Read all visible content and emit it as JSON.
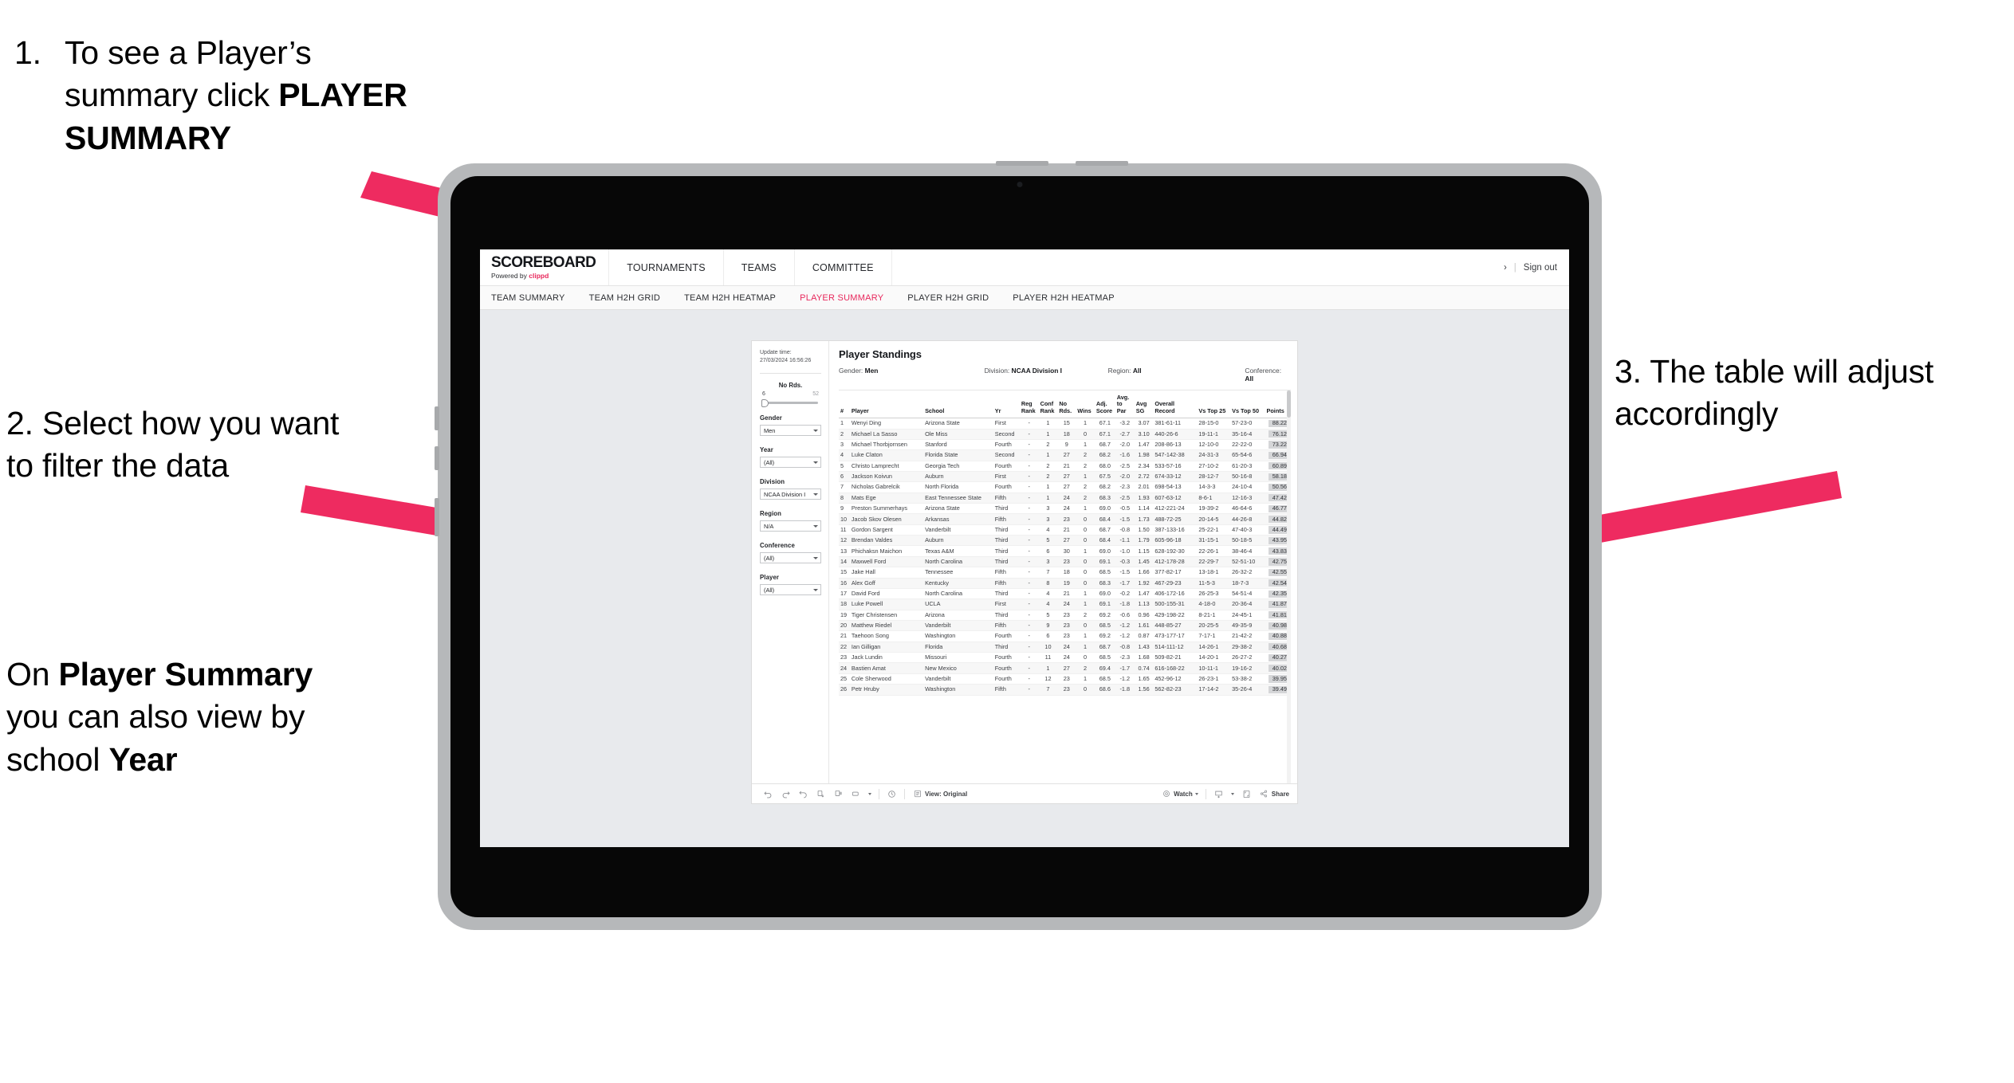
{
  "annotations": {
    "step1": {
      "number": "1.",
      "line1": "To see a Player’s",
      "line2_pre": "summary click ",
      "line2_bold": "PLAYER",
      "line3_bold": "SUMMARY"
    },
    "step2": {
      "text": "2. Select how you want to filter the data"
    },
    "step2b": {
      "pre": "On ",
      "bold1": "Player Summary",
      "mid": " you can also view by school ",
      "bold2": "Year"
    },
    "step3": {
      "text": "3. The table will adjust accordingly"
    }
  },
  "app": {
    "brand": {
      "name": "SCOREBOARD",
      "powered_by": "Powered by ",
      "vendor": "clippd"
    },
    "topnav": [
      "TOURNAMENTS",
      "TEAMS",
      "COMMITTEE"
    ],
    "top_right": {
      "chevron": "›",
      "divider": "|",
      "sign_out": "Sign out"
    },
    "subnav": [
      {
        "label": "TEAM SUMMARY",
        "active": false
      },
      {
        "label": "TEAM H2H GRID",
        "active": false
      },
      {
        "label": "TEAM H2H HEATMAP",
        "active": false
      },
      {
        "label": "PLAYER SUMMARY",
        "active": true
      },
      {
        "label": "PLAYER H2H GRID",
        "active": false
      },
      {
        "label": "PLAYER H2H HEATMAP",
        "active": false
      }
    ],
    "accent_color": "#e8285c"
  },
  "filters": {
    "update_time_label": "Update time:",
    "update_time_value": "27/03/2024 16:56:26",
    "slider": {
      "title": "No Rds.",
      "min": "6",
      "max": "52"
    },
    "groups": [
      {
        "title": "Gender",
        "value": "Men"
      },
      {
        "title": "Year",
        "value": "(All)"
      },
      {
        "title": "Division",
        "value": "NCAA Division I"
      },
      {
        "title": "Region",
        "value": "N/A"
      },
      {
        "title": "Conference",
        "value": "(All)"
      },
      {
        "title": "Player",
        "value": "(All)"
      }
    ]
  },
  "viz": {
    "title": "Player Standings",
    "active_filters": [
      {
        "label": "Gender: ",
        "value": "Men"
      },
      {
        "label": "Division: ",
        "value": "NCAA Division I"
      },
      {
        "label": "Region: ",
        "value": "All"
      },
      {
        "label": "Conference: ",
        "value": "All"
      }
    ],
    "columns": [
      "#",
      "Player",
      "School",
      "Yr",
      "Reg\nRank",
      "Conf\nRank",
      "No\nRds.",
      "Wins",
      "Adj.\nScore",
      "Avg.\nto Par",
      "Avg\nSG",
      "Overall\nRecord",
      "Vs Top 25",
      "Vs Top 50",
      "Points"
    ],
    "rows": [
      [
        "1",
        "Wenyi Ding",
        "Arizona State",
        "First",
        "-",
        "1",
        "15",
        "1",
        "67.1",
        "-3.2",
        "3.07",
        "381-61-11",
        "28-15-0",
        "57-23-0",
        "88.22"
      ],
      [
        "2",
        "Michael La Sasso",
        "Ole Miss",
        "Second",
        "-",
        "1",
        "18",
        "0",
        "67.1",
        "-2.7",
        "3.10",
        "440-26-6",
        "19-11-1",
        "35-16-4",
        "76.12"
      ],
      [
        "3",
        "Michael Thorbjornsen",
        "Stanford",
        "Fourth",
        "-",
        "2",
        "9",
        "1",
        "68.7",
        "-2.0",
        "1.47",
        "208-86-13",
        "12-10-0",
        "22-22-0",
        "73.22"
      ],
      [
        "4",
        "Luke Claton",
        "Florida State",
        "Second",
        "-",
        "1",
        "27",
        "2",
        "68.2",
        "-1.6",
        "1.98",
        "547-142-38",
        "24-31-3",
        "65-54-6",
        "66.94"
      ],
      [
        "5",
        "Christo Lamprecht",
        "Georgia Tech",
        "Fourth",
        "-",
        "2",
        "21",
        "2",
        "68.0",
        "-2.5",
        "2.34",
        "533-57-16",
        "27-10-2",
        "61-20-3",
        "60.89"
      ],
      [
        "6",
        "Jackson Koivun",
        "Auburn",
        "First",
        "-",
        "2",
        "27",
        "1",
        "67.5",
        "-2.0",
        "2.72",
        "674-33-12",
        "28-12-7",
        "50-16-8",
        "58.18"
      ],
      [
        "7",
        "Nicholas Gabrelcik",
        "North Florida",
        "Fourth",
        "-",
        "1",
        "27",
        "2",
        "68.2",
        "-2.3",
        "2.01",
        "698-54-13",
        "14-3-3",
        "24-10-4",
        "50.56"
      ],
      [
        "8",
        "Mats Ege",
        "East Tennessee State",
        "Fifth",
        "-",
        "1",
        "24",
        "2",
        "68.3",
        "-2.5",
        "1.93",
        "607-63-12",
        "8-6-1",
        "12-16-3",
        "47.42"
      ],
      [
        "9",
        "Preston Summerhays",
        "Arizona State",
        "Third",
        "-",
        "3",
        "24",
        "1",
        "69.0",
        "-0.5",
        "1.14",
        "412-221-24",
        "19-39-2",
        "46-64-6",
        "46.77"
      ],
      [
        "10",
        "Jacob Skov Olesen",
        "Arkansas",
        "Fifth",
        "-",
        "3",
        "23",
        "0",
        "68.4",
        "-1.5",
        "1.73",
        "488-72-25",
        "20-14-5",
        "44-26-8",
        "44.82"
      ],
      [
        "11",
        "Gordon Sargent",
        "Vanderbilt",
        "Third",
        "-",
        "4",
        "21",
        "0",
        "68.7",
        "-0.8",
        "1.50",
        "387-133-16",
        "25-22-1",
        "47-40-3",
        "44.49"
      ],
      [
        "12",
        "Brendan Valdes",
        "Auburn",
        "Third",
        "-",
        "5",
        "27",
        "0",
        "68.4",
        "-1.1",
        "1.79",
        "605-96-18",
        "31-15-1",
        "50-18-5",
        "43.95"
      ],
      [
        "13",
        "Phichaksn Maichon",
        "Texas A&M",
        "Third",
        "-",
        "6",
        "30",
        "1",
        "69.0",
        "-1.0",
        "1.15",
        "628-192-30",
        "22-26-1",
        "38-46-4",
        "43.83"
      ],
      [
        "14",
        "Maxwell Ford",
        "North Carolina",
        "Third",
        "-",
        "3",
        "23",
        "0",
        "69.1",
        "-0.3",
        "1.45",
        "412-178-28",
        "22-29-7",
        "52-51-10",
        "42.75"
      ],
      [
        "15",
        "Jake Hall",
        "Tennessee",
        "Fifth",
        "-",
        "7",
        "18",
        "0",
        "68.5",
        "-1.5",
        "1.66",
        "377-82-17",
        "13-18-1",
        "26-32-2",
        "42.55"
      ],
      [
        "16",
        "Alex Goff",
        "Kentucky",
        "Fifth",
        "-",
        "8",
        "19",
        "0",
        "68.3",
        "-1.7",
        "1.92",
        "467-29-23",
        "11-5-3",
        "18-7-3",
        "42.54"
      ],
      [
        "17",
        "David Ford",
        "North Carolina",
        "Third",
        "-",
        "4",
        "21",
        "1",
        "69.0",
        "-0.2",
        "1.47",
        "406-172-16",
        "26-25-3",
        "54-51-4",
        "42.35"
      ],
      [
        "18",
        "Luke Powell",
        "UCLA",
        "First",
        "-",
        "4",
        "24",
        "1",
        "69.1",
        "-1.8",
        "1.13",
        "500-155-31",
        "4-18-0",
        "20-36-4",
        "41.87"
      ],
      [
        "19",
        "Tiger Christensen",
        "Arizona",
        "Third",
        "-",
        "5",
        "23",
        "2",
        "69.2",
        "-0.6",
        "0.96",
        "429-198-22",
        "8-21-1",
        "24-45-1",
        "41.81"
      ],
      [
        "20",
        "Matthew Riedel",
        "Vanderbilt",
        "Fifth",
        "-",
        "9",
        "23",
        "0",
        "68.5",
        "-1.2",
        "1.61",
        "448-85-27",
        "20-25-5",
        "49-35-9",
        "40.98"
      ],
      [
        "21",
        "Taehoon Song",
        "Washington",
        "Fourth",
        "-",
        "6",
        "23",
        "1",
        "69.2",
        "-1.2",
        "0.87",
        "473-177-17",
        "7-17-1",
        "21-42-2",
        "40.88"
      ],
      [
        "22",
        "Ian Gilligan",
        "Florida",
        "Third",
        "-",
        "10",
        "24",
        "1",
        "68.7",
        "-0.8",
        "1.43",
        "514-111-12",
        "14-26-1",
        "29-38-2",
        "40.68"
      ],
      [
        "23",
        "Jack Lundin",
        "Missouri",
        "Fourth",
        "-",
        "11",
        "24",
        "0",
        "68.5",
        "-2.3",
        "1.68",
        "509-82-21",
        "14-20-1",
        "26-27-2",
        "40.27"
      ],
      [
        "24",
        "Bastien Amat",
        "New Mexico",
        "Fourth",
        "-",
        "1",
        "27",
        "2",
        "69.4",
        "-1.7",
        "0.74",
        "616-168-22",
        "10-11-1",
        "19-16-2",
        "40.02"
      ],
      [
        "25",
        "Cole Sherwood",
        "Vanderbilt",
        "Fourth",
        "-",
        "12",
        "23",
        "1",
        "68.5",
        "-1.2",
        "1.65",
        "452-96-12",
        "26-23-1",
        "53-38-2",
        "39.95"
      ],
      [
        "26",
        "Petr Hruby",
        "Washington",
        "Fifth",
        "-",
        "7",
        "23",
        "0",
        "68.6",
        "-1.8",
        "1.56",
        "562-82-23",
        "17-14-2",
        "35-26-4",
        "39.49"
      ]
    ]
  },
  "toolbar": {
    "view_label": "View: Original",
    "watch_label": "Watch",
    "share_label": "Share"
  }
}
